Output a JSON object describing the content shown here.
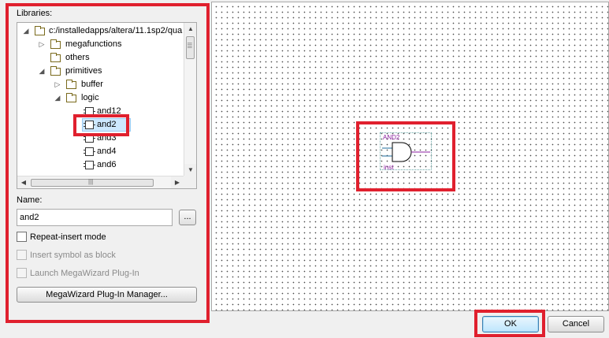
{
  "libraries": {
    "label": "Libraries:",
    "tree": [
      {
        "text": "c:/installedapps/altera/11.1sp2/qua",
        "type": "folder",
        "expander": "◢",
        "expanded": true
      },
      {
        "text": "megafunctions",
        "type": "folder",
        "expander": "▷",
        "expanded": false
      },
      {
        "text": "others",
        "type": "folder",
        "expander": "",
        "expanded": false
      },
      {
        "text": "primitives",
        "type": "folder",
        "expander": "◢",
        "expanded": true
      },
      {
        "text": "buffer",
        "type": "folder",
        "expander": "▷",
        "expanded": false
      },
      {
        "text": "logic",
        "type": "folder",
        "expander": "◢",
        "expanded": true
      },
      {
        "text": "and12",
        "type": "symbol",
        "selected": false
      },
      {
        "text": "and2",
        "type": "symbol",
        "selected": true
      },
      {
        "text": "and3",
        "type": "symbol",
        "selected": false
      },
      {
        "text": "and4",
        "type": "symbol",
        "selected": false
      },
      {
        "text": "and6",
        "type": "symbol",
        "selected": false
      }
    ]
  },
  "name": {
    "label": "Name:",
    "value": "and2",
    "browse_label": "..."
  },
  "options": {
    "repeat_insert": {
      "label": "Repeat-insert mode",
      "checked": false,
      "enabled": true
    },
    "insert_as_block": {
      "label": "Insert symbol as block",
      "checked": false,
      "enabled": false
    },
    "launch_megawizard": {
      "label": "Launch MegaWizard Plug-In",
      "checked": false,
      "enabled": false
    }
  },
  "megawizard_button": "MegaWizard Plug-In Manager...",
  "preview": {
    "symbol_name": "AND2",
    "instance_name": "inst"
  },
  "buttons": {
    "ok": "OK",
    "cancel": "Cancel"
  },
  "colors": {
    "highlight": "#e0202e",
    "symbol_text": "#8b1fa0",
    "symbol_wire": "#1e6e9e"
  },
  "icons": {
    "folder": "folder-icon",
    "symbol": "symbol-icon",
    "expand": "expand-arrow-icon",
    "collapse": "collapse-arrow-icon"
  }
}
